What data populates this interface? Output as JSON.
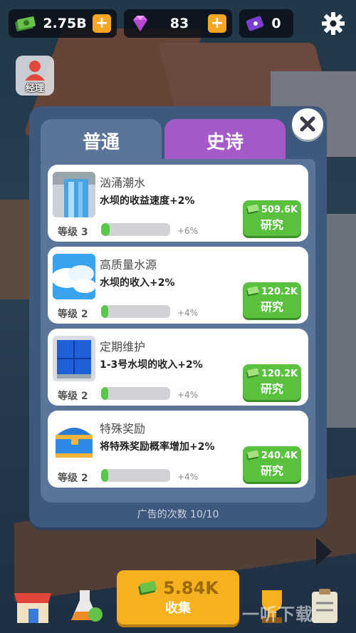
{
  "currency": {
    "money": "2.75B",
    "gems": "83",
    "tickets": "0"
  },
  "manager_label": "经理",
  "tabs": {
    "normal": "普通",
    "epic": "史诗"
  },
  "upgrades": [
    {
      "title": "汹涌潮水",
      "desc": "水坝的收益速度+2%",
      "level": "等级 3",
      "increase": "+6%",
      "progress": 0.12,
      "cost": "509.6K",
      "action": "研究",
      "icon": "waterfall-icon"
    },
    {
      "title": "高质量水源",
      "desc": "水坝的收入+2%",
      "level": "等级 2",
      "increase": "+4%",
      "progress": 0.1,
      "cost": "120.2K",
      "action": "研究",
      "icon": "cloud-sky-icon"
    },
    {
      "title": "定期维护",
      "desc": "1-3号水坝的收入+2%",
      "level": "等级 2",
      "increase": "+4%",
      "progress": 0.1,
      "cost": "120.2K",
      "action": "研究",
      "icon": "blue-panel-icon"
    },
    {
      "title": "特殊奖励",
      "desc": "将特殊奖励概率增加+2%",
      "level": "等级 2",
      "increase": "+4%",
      "progress": 0.1,
      "cost": "240.4K",
      "action": "研究",
      "icon": "treasure-chest-icon"
    }
  ],
  "ad_count": "广告的次数 10/10",
  "collect": {
    "amount": "5.84K",
    "label": "收集"
  },
  "watermark": "一听下载",
  "colors": {
    "research_green": "#5ac13f",
    "collect_gold": "#f5b21e",
    "epic_purple": "#a45bc7",
    "plus_orange": "#f6a623"
  }
}
